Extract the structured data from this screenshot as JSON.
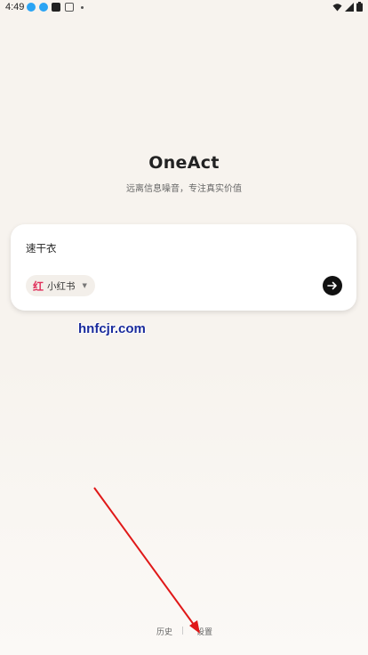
{
  "status_bar": {
    "time": "4:49"
  },
  "app": {
    "title": "OneAct",
    "subtitle": "远离信息噪音，专注真实价值"
  },
  "search_card": {
    "query": "速干衣",
    "platform": {
      "icon": "红",
      "label": "小红书"
    }
  },
  "watermark": "hnfcjr.com",
  "bottom_nav": {
    "history": "历史",
    "settings": "设置"
  },
  "colors": {
    "background": "#f7f3ee",
    "platform_red": "#e0305b",
    "go_button": "#111111",
    "arrow": "#e01818",
    "watermark": "#1a2b9c"
  },
  "icons": [
    "signal-icon",
    "wifi-icon",
    "battery-icon",
    "arrow-right-icon",
    "chevron-down-icon"
  ]
}
